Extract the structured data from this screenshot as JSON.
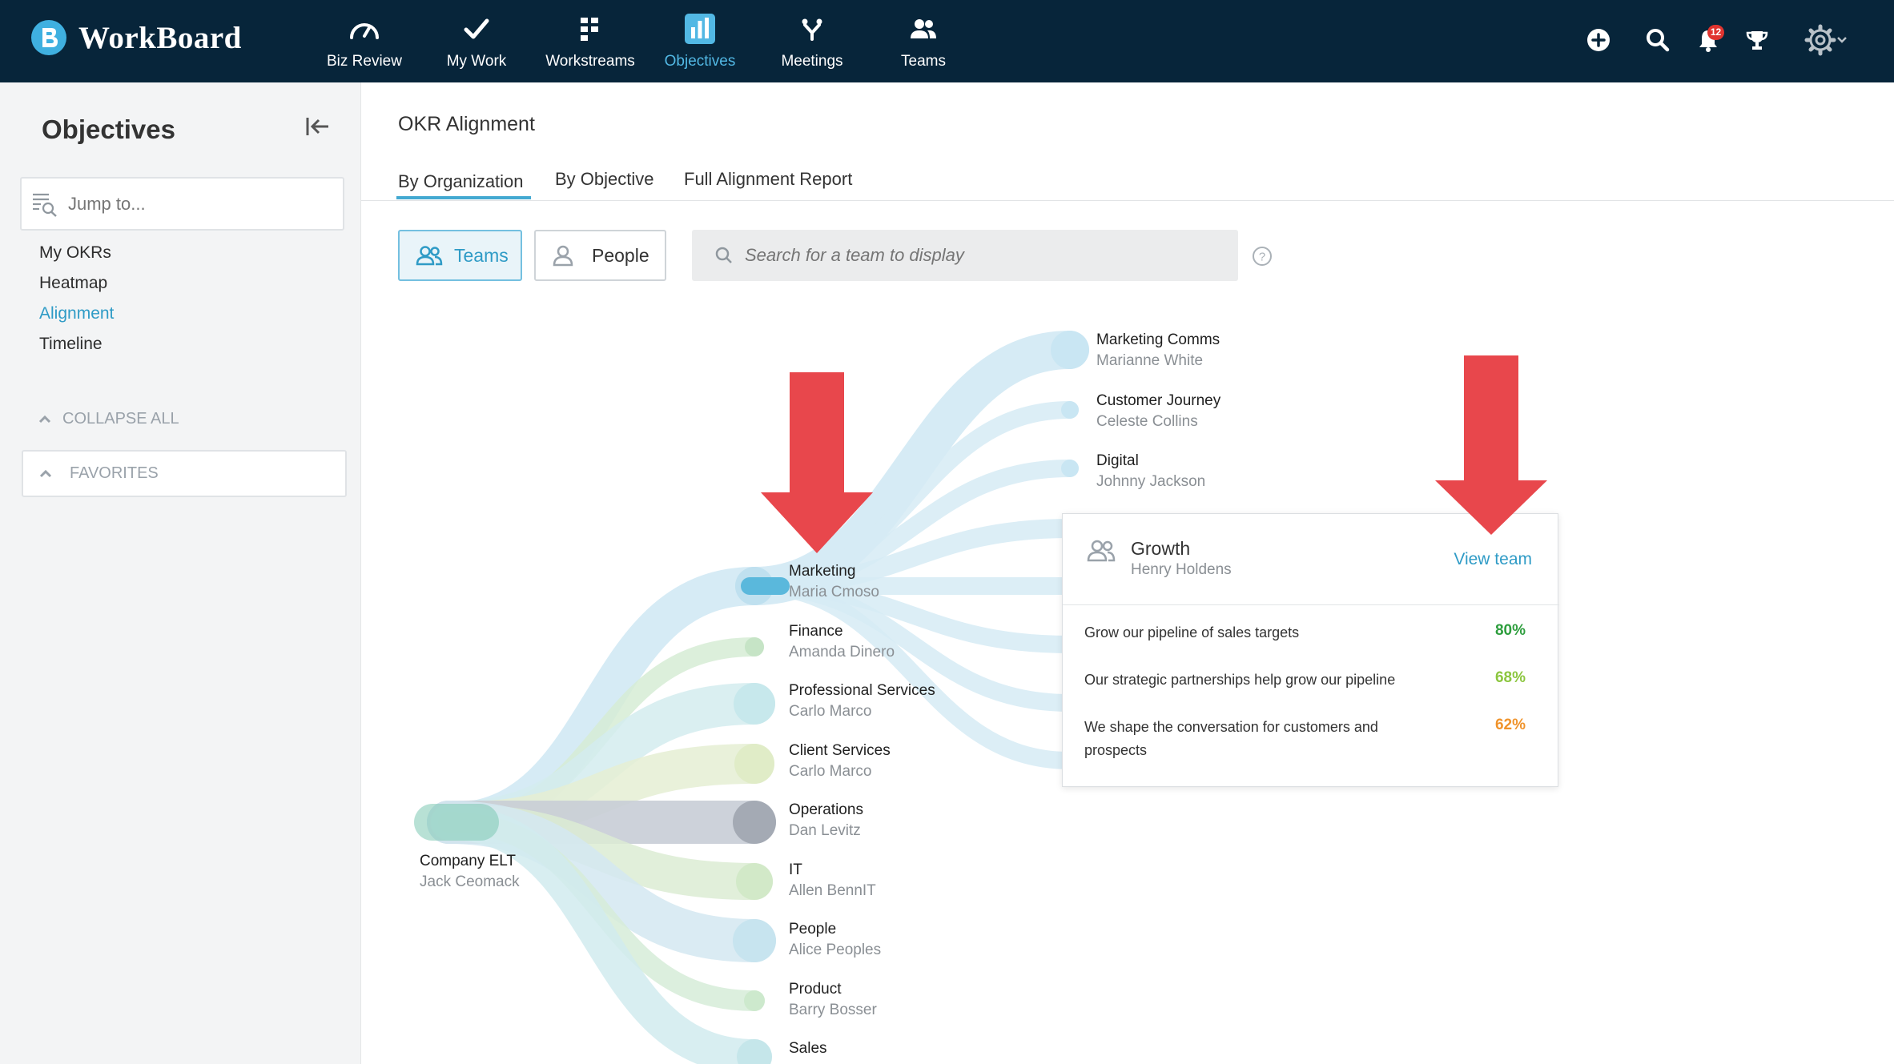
{
  "brand": {
    "name": "WorkBoard"
  },
  "nav": [
    {
      "label": "Biz Review",
      "icon": "gauge-icon"
    },
    {
      "label": "My Work",
      "icon": "check-icon"
    },
    {
      "label": "Workstreams",
      "icon": "workstreams-icon"
    },
    {
      "label": "Objectives",
      "icon": "bar-chart-icon",
      "active": true
    },
    {
      "label": "Meetings",
      "icon": "meetings-icon"
    },
    {
      "label": "Teams",
      "icon": "teams-icon"
    }
  ],
  "topbar": {
    "notifications_count": "12"
  },
  "sidebar": {
    "title": "Objectives",
    "jump_placeholder": "Jump to...",
    "links": [
      "My OKRs",
      "Heatmap",
      "Alignment",
      "Timeline"
    ],
    "active_link": "Alignment",
    "collapse_all": "COLLAPSE ALL",
    "favorites": "FAVORITES"
  },
  "main": {
    "title": "OKR Alignment",
    "tabs": [
      "By Organization",
      "By Objective",
      "Full Alignment Report"
    ],
    "active_tab": "By Organization",
    "toggle": {
      "teams": "Teams",
      "people": "People"
    },
    "search_placeholder": "Search for a team to display"
  },
  "tree": {
    "root": {
      "name": "Company ELT",
      "owner": "Jack Ceomack"
    },
    "level1": [
      {
        "name": "Marketing",
        "owner": "Maria Cmoso"
      },
      {
        "name": "Finance",
        "owner": "Amanda Dinero"
      },
      {
        "name": "Professional Services",
        "owner": "Carlo Marco"
      },
      {
        "name": "Client Services",
        "owner": "Carlo Marco"
      },
      {
        "name": "Operations",
        "owner": "Dan Levitz"
      },
      {
        "name": "IT",
        "owner": "Allen BennIT"
      },
      {
        "name": "People",
        "owner": "Alice Peoples"
      },
      {
        "name": "Product",
        "owner": "Barry Bosser"
      },
      {
        "name": "Sales",
        "owner": ""
      }
    ],
    "level2": [
      {
        "name": "Marketing Comms",
        "owner": "Marianne White"
      },
      {
        "name": "Customer Journey",
        "owner": "Celeste Collins"
      },
      {
        "name": "Digital",
        "owner": "Johnny Jackson"
      }
    ]
  },
  "popover": {
    "team": "Growth",
    "owner": "Henry Holdens",
    "link": "View team",
    "objectives": [
      {
        "text": "Grow our pipeline of sales targets",
        "pct": "80%",
        "color": "#2e9e3e"
      },
      {
        "text": "Our strategic partnerships help grow our pipeline",
        "pct": "68%",
        "color": "#8cc63f"
      },
      {
        "text": "We shape the conversation for customers and prospects",
        "pct": "62%",
        "color": "#f0932b"
      }
    ]
  },
  "colors": {
    "topbar": "#07253a",
    "accent": "#2f9bc6",
    "arrow": "#e8474c"
  }
}
